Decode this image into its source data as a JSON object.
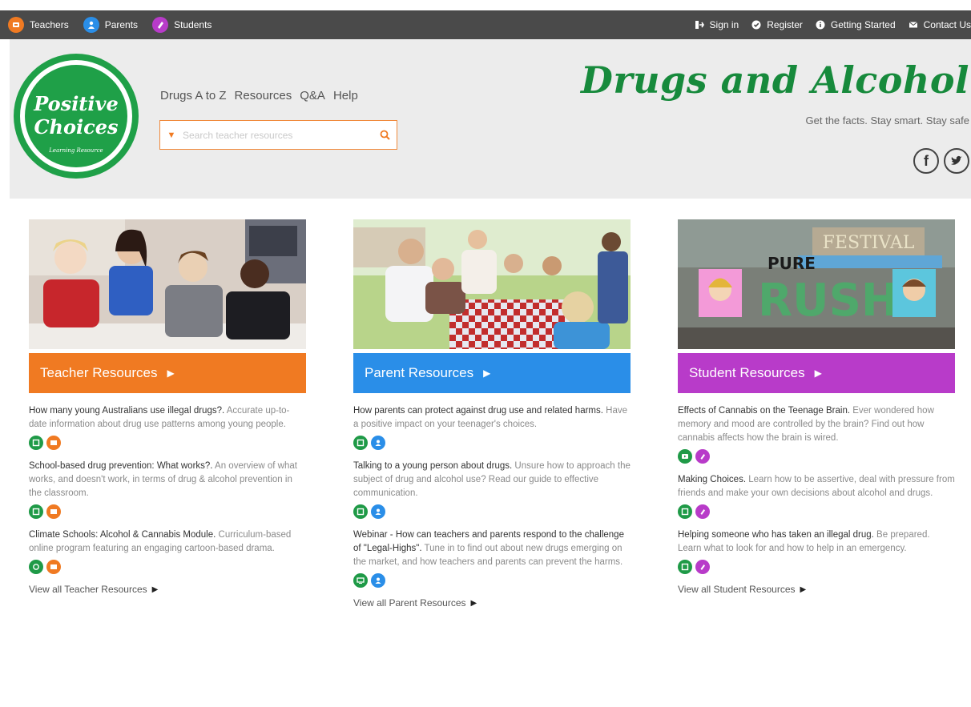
{
  "topbar": {
    "left": [
      {
        "label": "Teachers",
        "icon": "teachers-icon",
        "color": "#f07a22"
      },
      {
        "label": "Parents",
        "icon": "parents-icon",
        "color": "#2a8ee8"
      },
      {
        "label": "Students",
        "icon": "students-icon",
        "color": "#b83bc9"
      }
    ],
    "right": [
      {
        "label": "Sign in",
        "icon": "signin-icon"
      },
      {
        "label": "Register",
        "icon": "register-icon"
      },
      {
        "label": "Getting Started",
        "icon": "info-icon"
      },
      {
        "label": "Contact Us",
        "icon": "mail-icon"
      }
    ]
  },
  "header": {
    "logo": {
      "line1": "Positive",
      "line2": "Choices",
      "tagline": "Learning Resource",
      "color": "#1fa048"
    },
    "nav": [
      "Drugs A to Z",
      "Resources",
      "Q&A",
      "Help"
    ],
    "search_placeholder": "Search teacher resources",
    "title": "Drugs and Alcohol",
    "subtitle": "Get the facts. Stay smart. Stay safe",
    "social": [
      "facebook-icon",
      "twitter-icon"
    ]
  },
  "columns": [
    {
      "banner": "Teacher Resources",
      "color": "#f07a22",
      "items": [
        {
          "title": "How many young Australians use illegal drugs?.",
          "desc": " Accurate up-to-date information about drug use patterns among young people.",
          "icons": [
            "#1f9a47",
            "#f07a22"
          ]
        },
        {
          "title": "School-based drug prevention: What works?.",
          "desc": " An overview of what works, and doesn't work, in terms of drug & alcohol prevention in the classroom.",
          "icons": [
            "#1f9a47",
            "#f07a22"
          ]
        },
        {
          "title": "Climate Schools: Alcohol & Cannabis Module.",
          "desc": " Curriculum-based online program featuring an engaging cartoon-based drama.",
          "icons": [
            "#1f9a47",
            "#f07a22"
          ]
        }
      ],
      "view_all": "View all Teacher Resources"
    },
    {
      "banner": "Parent Resources",
      "color": "#2a8ee8",
      "items": [
        {
          "title": "How parents can protect against drug use and related harms.",
          "desc": " Have a positive impact on your teenager's choices.",
          "icons": [
            "#1f9a47",
            "#2a8ee8"
          ]
        },
        {
          "title": "Talking to a young person about drugs.",
          "desc": " Unsure how to approach the subject of drug and alcohol use? Read our guide to effective communication.",
          "icons": [
            "#1f9a47",
            "#2a8ee8"
          ]
        },
        {
          "title": "Webinar - How can teachers and parents respond to the challenge of \"Legal-Highs\".",
          "desc": " Tune in to find out about new drugs emerging on the market, and how teachers and parents can prevent the harms.",
          "icons": [
            "#1f9a47",
            "#2a8ee8"
          ]
        }
      ],
      "view_all": "View all Parent Resources"
    },
    {
      "banner": "Student Resources",
      "color": "#b83bc9",
      "items": [
        {
          "title": "Effects of Cannabis on the Teenage Brain.",
          "desc": " Ever wondered how memory and mood are controlled by the brain? Find out how cannabis affects how the brain is wired.",
          "icons": [
            "#1f9a47",
            "#b83bc9"
          ]
        },
        {
          "title": "Making Choices.",
          "desc": " Learn how to be assertive, deal with pressure from friends and make your own decisions about alcohol and drugs.",
          "icons": [
            "#1f9a47",
            "#b83bc9"
          ]
        },
        {
          "title": "Helping someone who has taken an illegal drug.",
          "desc": " Be prepared. Learn what to look for and how to help in an emergency.",
          "icons": [
            "#1f9a47",
            "#b83bc9"
          ]
        }
      ],
      "view_all": "View all Student Resources",
      "image_text": {
        "festival": "FESTIVAL",
        "pure": "PURE",
        "rush": "RUSH"
      }
    }
  ]
}
